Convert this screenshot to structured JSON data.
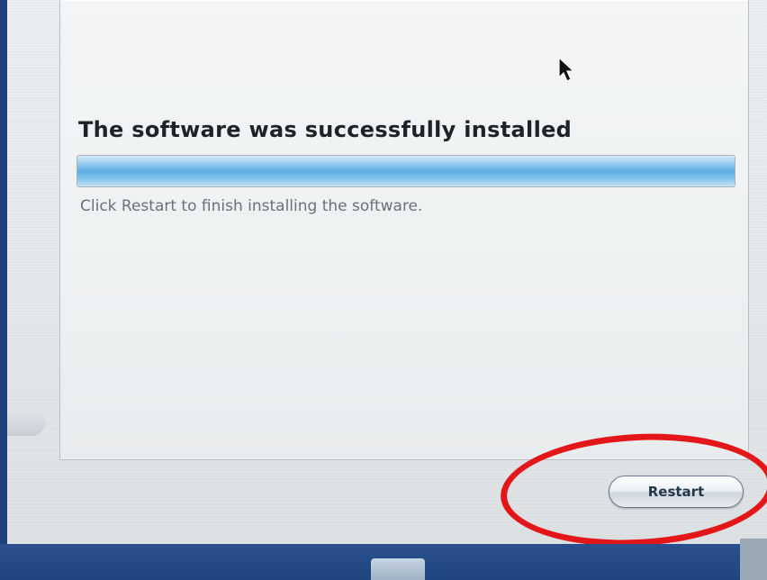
{
  "installer": {
    "title": "The software was successfully installed",
    "progress": 1.0,
    "message": "Click Restart to finish installing the software.",
    "restart_label": "Restart"
  },
  "colors": {
    "progress_blue": "#5eaee4",
    "highlight_ring": "#e3171a",
    "desktop_blue": "#1e3f79"
  },
  "icons": {
    "cursor": "arrow-cursor-icon"
  }
}
